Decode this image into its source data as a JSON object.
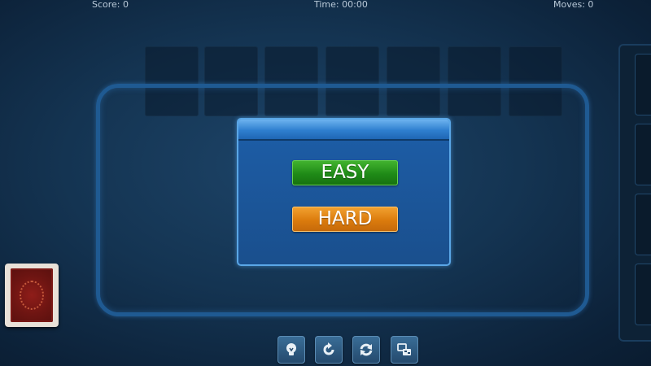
{
  "hud": {
    "score": "Score: 0",
    "time": "Time: 00:00",
    "moves": "Moves: 0"
  },
  "dialog": {
    "easy_label": "EASY",
    "hard_label": "HARD"
  },
  "toolbar": {
    "buttons": [
      {
        "icon": "lightbulb-icon"
      },
      {
        "icon": "undo-icon"
      },
      {
        "icon": "restart-icon"
      },
      {
        "icon": "cards-icon"
      }
    ]
  },
  "colors": {
    "background": "#143452",
    "table_border": "#1f5a92",
    "easy_button": "#1f8a17",
    "hard_button": "#db7b0d",
    "dialog": "#1a4f8d"
  }
}
